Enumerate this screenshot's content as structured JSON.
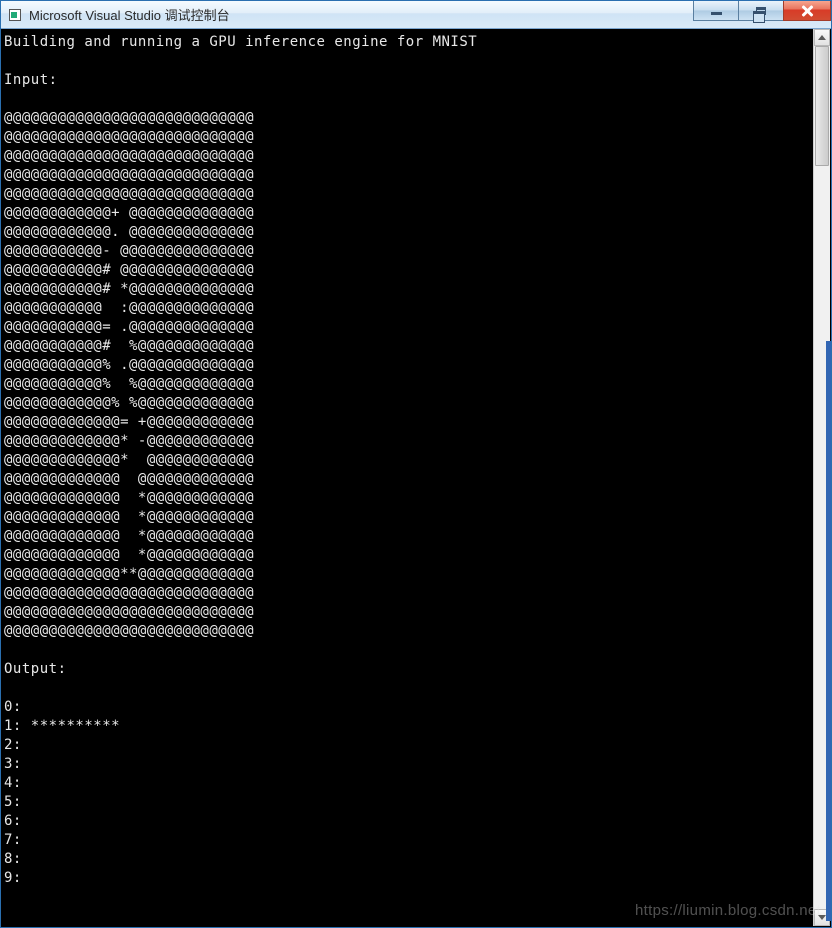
{
  "window": {
    "title": "Microsoft Visual Studio 调试控制台"
  },
  "console": {
    "lines": [
      "Building and running a GPU inference engine for MNIST",
      "",
      "Input:",
      "",
      "@@@@@@@@@@@@@@@@@@@@@@@@@@@@",
      "@@@@@@@@@@@@@@@@@@@@@@@@@@@@",
      "@@@@@@@@@@@@@@@@@@@@@@@@@@@@",
      "@@@@@@@@@@@@@@@@@@@@@@@@@@@@",
      "@@@@@@@@@@@@@@@@@@@@@@@@@@@@",
      "@@@@@@@@@@@@+ @@@@@@@@@@@@@@",
      "@@@@@@@@@@@@. @@@@@@@@@@@@@@",
      "@@@@@@@@@@@- @@@@@@@@@@@@@@@",
      "@@@@@@@@@@@# @@@@@@@@@@@@@@@",
      "@@@@@@@@@@@# *@@@@@@@@@@@@@@",
      "@@@@@@@@@@@  :@@@@@@@@@@@@@@",
      "@@@@@@@@@@@= .@@@@@@@@@@@@@@",
      "@@@@@@@@@@@#  %@@@@@@@@@@@@@",
      "@@@@@@@@@@@% .@@@@@@@@@@@@@@",
      "@@@@@@@@@@@%  %@@@@@@@@@@@@@",
      "@@@@@@@@@@@@% %@@@@@@@@@@@@@",
      "@@@@@@@@@@@@@= +@@@@@@@@@@@@",
      "@@@@@@@@@@@@@* -@@@@@@@@@@@@",
      "@@@@@@@@@@@@@*  @@@@@@@@@@@@",
      "@@@@@@@@@@@@@  @@@@@@@@@@@@@",
      "@@@@@@@@@@@@@  *@@@@@@@@@@@@",
      "@@@@@@@@@@@@@  *@@@@@@@@@@@@",
      "@@@@@@@@@@@@@  *@@@@@@@@@@@@",
      "@@@@@@@@@@@@@  *@@@@@@@@@@@@",
      "@@@@@@@@@@@@@**@@@@@@@@@@@@@",
      "@@@@@@@@@@@@@@@@@@@@@@@@@@@@",
      "@@@@@@@@@@@@@@@@@@@@@@@@@@@@",
      "@@@@@@@@@@@@@@@@@@@@@@@@@@@@",
      "",
      "Output:",
      "",
      "0: ",
      "1: **********",
      "2: ",
      "3: ",
      "4: ",
      "5: ",
      "6: ",
      "7: ",
      "8: ",
      "9: "
    ]
  },
  "watermark": "https://liumin.blog.csdn.net"
}
